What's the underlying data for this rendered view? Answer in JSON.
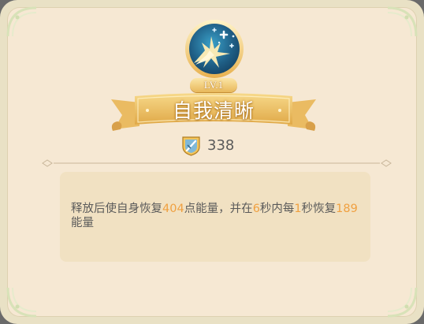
{
  "skill": {
    "level": "LV.1",
    "name": "自我清晰",
    "cost": "338",
    "icon": "energy-burst-icon",
    "cost_icon": "shield-sword-icon"
  },
  "description": {
    "p1": "释放后使自身恢复",
    "v1": "404",
    "p2": "点能量，并在",
    "v2": "6",
    "p3": "秒内每",
    "v3": "1",
    "p4": "秒恢复",
    "v4": "189",
    "p5": "能量"
  },
  "colors": {
    "panel_bg": "#f6e8d3",
    "desc_bg": "#f1e1c2",
    "highlight": "#f0a040",
    "text": "#5a5a5a",
    "gold": "#e8b85b",
    "emblem_blue": "#1f5f86"
  }
}
